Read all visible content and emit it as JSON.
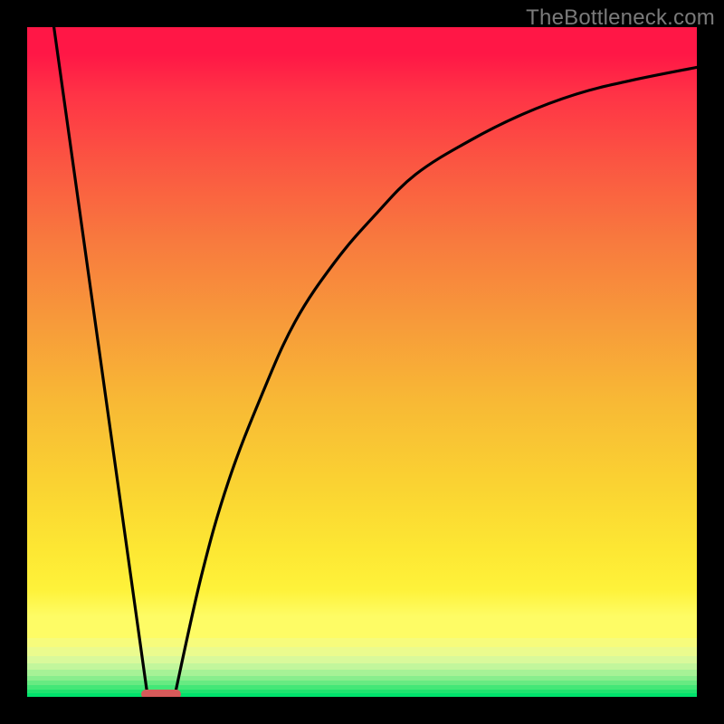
{
  "watermark": "TheBottleneck.com",
  "chart_data": {
    "type": "line",
    "title": "",
    "xlabel": "",
    "ylabel": "",
    "xlim": [
      0,
      100
    ],
    "ylim": [
      0,
      100
    ],
    "series": [
      {
        "name": "left-branch",
        "x": [
          4,
          18
        ],
        "y": [
          100,
          0
        ]
      },
      {
        "name": "right-branch",
        "x": [
          22,
          26,
          30,
          35,
          40,
          46,
          52,
          58,
          66,
          74,
          82,
          90,
          100
        ],
        "y": [
          0,
          18,
          32,
          45,
          56,
          65,
          72,
          78,
          83,
          87,
          90,
          92,
          94
        ]
      }
    ],
    "optimal_marker": {
      "x_start": 17,
      "x_end": 23,
      "y": 0.4
    },
    "background_gradient": {
      "top_color": "#ff1746",
      "bottom_color": "#00e36c",
      "bands_bottom": [
        {
          "color": "#fefc65",
          "from_pct": 88.2,
          "to_pct": 91.2
        },
        {
          "color": "#f7fc7c",
          "from_pct": 91.2,
          "to_pct": 92.6
        },
        {
          "color": "#ebfb8e",
          "from_pct": 92.6,
          "to_pct": 93.9
        },
        {
          "color": "#d9f99b",
          "from_pct": 93.9,
          "to_pct": 95.0
        },
        {
          "color": "#c2f69c",
          "from_pct": 95.0,
          "to_pct": 96.0
        },
        {
          "color": "#a6f296",
          "from_pct": 96.0,
          "to_pct": 96.9
        },
        {
          "color": "#88ee8d",
          "from_pct": 96.9,
          "to_pct": 97.6
        },
        {
          "color": "#67ea82",
          "from_pct": 97.6,
          "to_pct": 98.3
        },
        {
          "color": "#43e777",
          "from_pct": 98.3,
          "to_pct": 98.9
        },
        {
          "color": "#1fe46f",
          "from_pct": 98.9,
          "to_pct": 99.5
        },
        {
          "color": "#00e36c",
          "from_pct": 99.5,
          "to_pct": 100
        }
      ]
    }
  }
}
